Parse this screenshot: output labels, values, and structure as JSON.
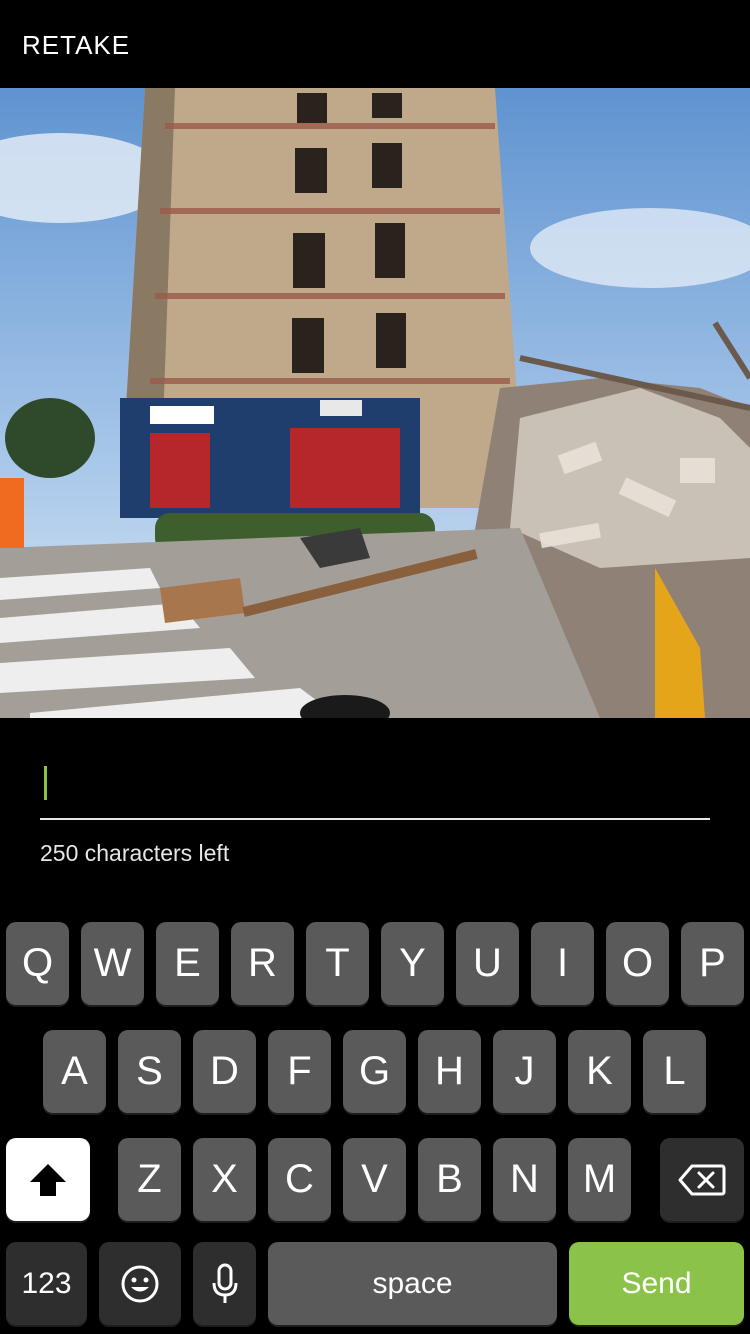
{
  "header": {
    "retake_label": "RETAKE"
  },
  "caption": {
    "value": "",
    "counter_text": "250 characters left"
  },
  "keyboard": {
    "row1": [
      "Q",
      "W",
      "E",
      "R",
      "T",
      "Y",
      "U",
      "I",
      "O",
      "P"
    ],
    "row2": [
      "A",
      "S",
      "D",
      "F",
      "G",
      "H",
      "J",
      "K",
      "L"
    ],
    "row3": [
      "Z",
      "X",
      "C",
      "V",
      "B",
      "N",
      "M"
    ],
    "numbers_label": "123",
    "space_label": "space",
    "send_label": "Send",
    "shift_icon": "shift-arrow-icon",
    "backspace_icon": "backspace-icon",
    "emoji_icon": "emoji-icon",
    "mic_icon": "microphone-icon"
  },
  "colors": {
    "accent": "#8bc34a",
    "key": "#5a5a5a",
    "key_dark": "#2e2e2e"
  }
}
